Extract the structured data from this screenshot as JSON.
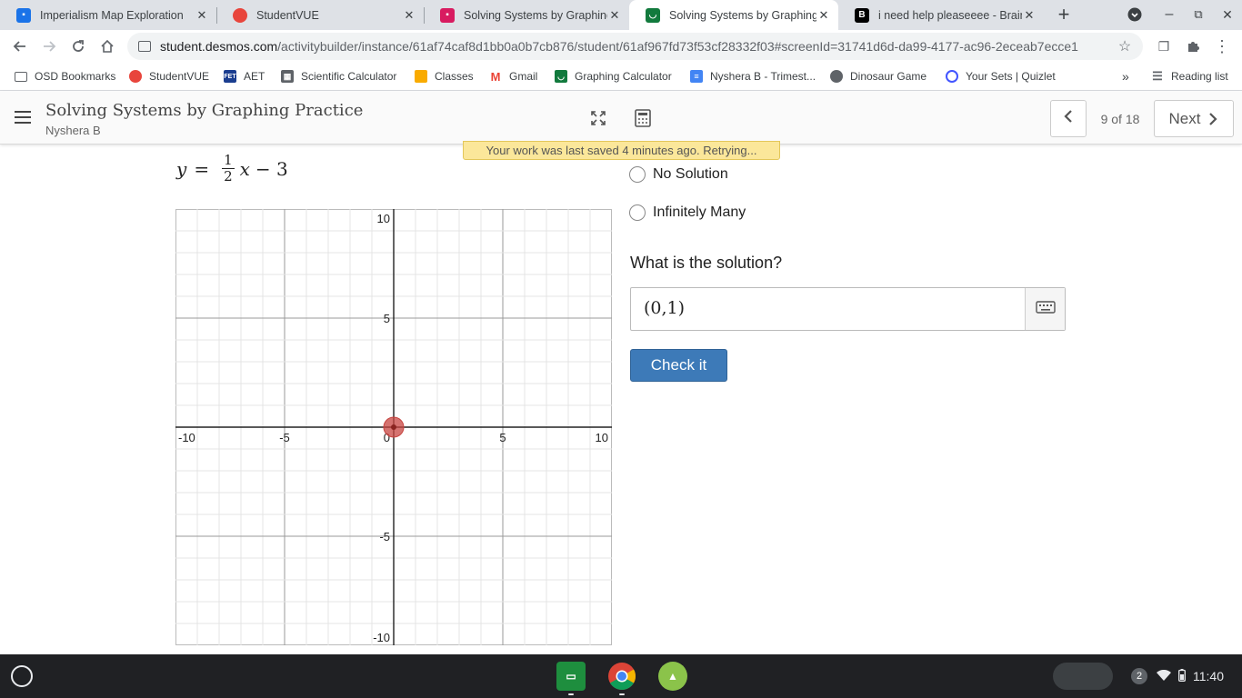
{
  "browser": {
    "tabs": [
      {
        "title": "Imperialism Map Exploration",
        "icon": "google-classroom-icon",
        "color": "#1a73e8"
      },
      {
        "title": "StudentVUE",
        "icon": "studentvue-icon",
        "color": "#e8453c"
      },
      {
        "title": "Solving Systems by Graphing Practice",
        "icon": "classes-icon",
        "color": "#d81b60"
      },
      {
        "title": "Solving Systems by Graphing Practice",
        "icon": "desmos-icon",
        "color": "#127a3d"
      },
      {
        "title": "i need help pleaseeee - Brainly",
        "icon": "brainly-icon",
        "color": "#000000"
      }
    ],
    "active_tab_index": 3,
    "url_host": "student.desmos.com",
    "url_path": "/activitybuilder/instance/61af74caf8d1bb0a0b7cb876/student/61af967fd73f53cf28332f03#screenId=31741d6d-da99-4177-ac96-2eceab7ecce1",
    "bookmarks": [
      {
        "label": "OSD Bookmarks",
        "icon": "folder-icon",
        "color": "#5f6368"
      },
      {
        "label": "StudentVUE",
        "icon": "studentvue-icon",
        "color": "#e8453c"
      },
      {
        "label": "AET",
        "icon": "aet-icon",
        "color": "#1a3d8f"
      },
      {
        "label": "Scientific Calculator",
        "icon": "calculator-icon",
        "color": "#5f6368"
      },
      {
        "label": "Classes",
        "icon": "google-classroom-icon",
        "color": "#f9ab00"
      },
      {
        "label": "Gmail",
        "icon": "gmail-icon",
        "color": "#ea4335"
      },
      {
        "label": "Graphing Calculator",
        "icon": "desmos-icon",
        "color": "#127a3d"
      },
      {
        "label": "Nyshera B - Trimest...",
        "icon": "google-docs-icon",
        "color": "#4285f4"
      },
      {
        "label": "Dinosaur Game",
        "icon": "globe-icon",
        "color": "#5f6368"
      },
      {
        "label": "Your Sets | Quizlet",
        "icon": "quizlet-icon",
        "color": "#4255ff"
      }
    ],
    "reading_list_label": "Reading list"
  },
  "activity": {
    "title": "Solving Systems by Graphing Practice",
    "student": "Nyshera B",
    "pager_text": "9 of 18",
    "next_label": "Next",
    "saved_banner": "Your work was last saved 4 minutes ago. Retrying..."
  },
  "equation": {
    "lhs": "y",
    "equals": "=",
    "numerator": "1",
    "denominator": "2",
    "variable": "x",
    "tail": "− 3"
  },
  "graph": {
    "xmin": -10,
    "xmax": 10,
    "ymin": -10,
    "ymax": 10,
    "grid_step": 1,
    "major_step": 5,
    "x_tick_labels": [
      "-10",
      "-5",
      "0",
      "5",
      "10"
    ],
    "y_tick_labels": [
      "10",
      "5",
      "-5",
      "-10"
    ],
    "point": {
      "x": 0,
      "y": 0,
      "color": "#c74440"
    }
  },
  "choices": [
    {
      "label": "No Solution"
    },
    {
      "label": "Infinitely Many"
    }
  ],
  "question": "What is the solution?",
  "answer_value": "(0,1)",
  "check_button": "Check it",
  "taskbar": {
    "apps": [
      {
        "name": "google-classroom-icon",
        "color": "#1e8e3e"
      },
      {
        "name": "chrome-icon",
        "color": "#db4437"
      },
      {
        "name": "android-app-icon",
        "color": "#8bc34a"
      }
    ],
    "notification_count": "2",
    "time": "11:40"
  }
}
